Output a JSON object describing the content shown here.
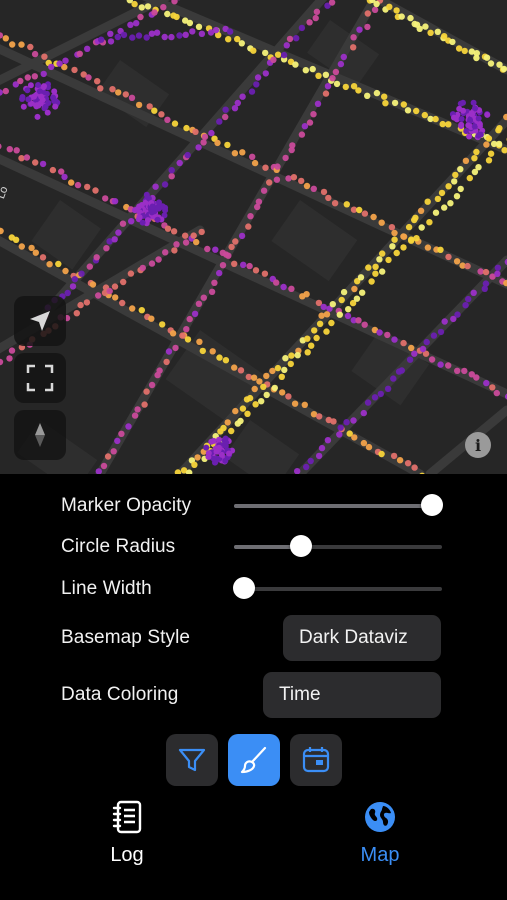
{
  "map": {
    "road_label": "Lo",
    "controls": [
      "locate-icon",
      "fullscreen-icon",
      "compass-icon"
    ],
    "info_glyph": "i",
    "palette": {
      "background": "#262626",
      "roads": "#3a3a3a",
      "time_colors": [
        "#2a1a8f",
        "#6a1fb0",
        "#9b2fc7",
        "#c94a9a",
        "#e0706a",
        "#f2a24a",
        "#f7d43a",
        "#f5f27a"
      ]
    }
  },
  "controls": {
    "marker_opacity": {
      "label": "Marker Opacity",
      "value": 0.95
    },
    "circle_radius": {
      "label": "Circle Radius",
      "value": 0.32
    },
    "line_width": {
      "label": "Line Width",
      "value": 0.05
    },
    "basemap_style": {
      "label": "Basemap Style",
      "value": "Dark Dataviz"
    },
    "data_coloring": {
      "label": "Data Coloring",
      "value": "Time"
    }
  },
  "toolbar": {
    "buttons": [
      {
        "icon": "filter-icon",
        "active": false
      },
      {
        "icon": "brush-icon",
        "active": true
      },
      {
        "icon": "calendar-icon",
        "active": false
      }
    ],
    "accent": "#3b8ef5"
  },
  "tabbar": {
    "tabs": [
      {
        "label": "Log",
        "icon": "notebook-icon",
        "active": false
      },
      {
        "label": "Map",
        "icon": "globe-icon",
        "active": true
      }
    ],
    "active_color": "#3b8ef5"
  }
}
